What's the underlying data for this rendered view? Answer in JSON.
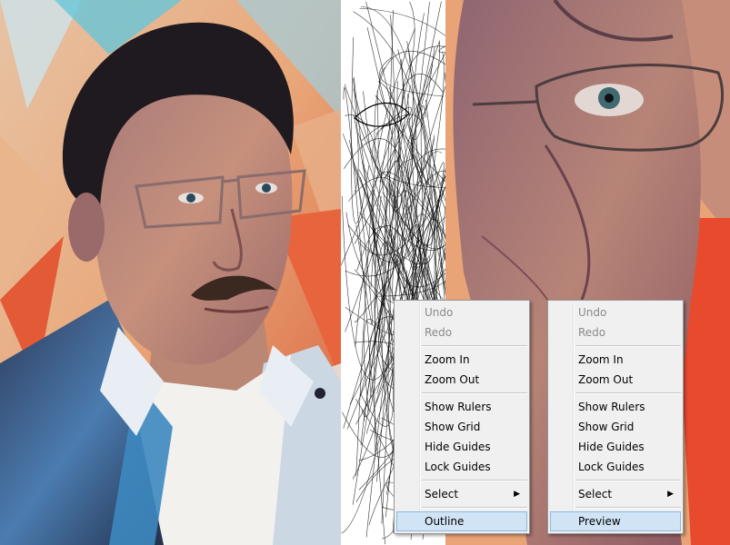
{
  "menus": {
    "outline_menu": {
      "items": [
        {
          "label": "Undo",
          "enabled": false
        },
        {
          "label": "Redo",
          "enabled": false
        },
        {
          "label": "Zoom In",
          "enabled": true
        },
        {
          "label": "Zoom Out",
          "enabled": true
        },
        {
          "label": "Show Rulers",
          "enabled": true
        },
        {
          "label": "Show Grid",
          "enabled": true
        },
        {
          "label": "Hide Guides",
          "enabled": true
        },
        {
          "label": "Lock Guides",
          "enabled": true
        },
        {
          "label": "Select",
          "enabled": true,
          "submenu": true
        },
        {
          "label": "Outline",
          "enabled": true,
          "highlighted": true
        }
      ]
    },
    "preview_menu": {
      "items": [
        {
          "label": "Undo",
          "enabled": false
        },
        {
          "label": "Redo",
          "enabled": false
        },
        {
          "label": "Zoom In",
          "enabled": true
        },
        {
          "label": "Zoom Out",
          "enabled": true
        },
        {
          "label": "Show Rulers",
          "enabled": true
        },
        {
          "label": "Show Grid",
          "enabled": true
        },
        {
          "label": "Hide Guides",
          "enabled": true
        },
        {
          "label": "Lock Guides",
          "enabled": true
        },
        {
          "label": "Select",
          "enabled": true,
          "submenu": true
        },
        {
          "label": "Preview",
          "enabled": true,
          "highlighted": true
        }
      ]
    }
  },
  "icons": {
    "submenu_arrow": "triangle-right-icon"
  },
  "colors": {
    "menu_bg": "#f0f0f0",
    "menu_border": "#979797",
    "highlight_bg": "#d1e4f5",
    "highlight_border": "#8fb7dd",
    "disabled_text": "#8a8a8a"
  }
}
